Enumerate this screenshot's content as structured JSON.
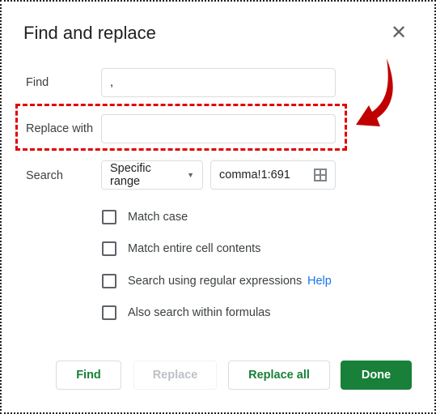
{
  "dialog": {
    "title": "Find and replace",
    "close_icon": "close-icon",
    "find": {
      "label": "Find",
      "value": ","
    },
    "replace": {
      "label": "Replace with",
      "value": "",
      "highlight_color": "#e00000"
    },
    "search": {
      "label": "Search",
      "scope": "Specific range",
      "range": "comma!1:691",
      "range_icon": "grid-icon"
    },
    "options": [
      {
        "label": "Match case",
        "checked": false
      },
      {
        "label": "Match entire cell contents",
        "checked": false
      },
      {
        "label": "Search using regular expressions",
        "checked": false,
        "help": "Help"
      },
      {
        "label": "Also search within formulas",
        "checked": false
      }
    ],
    "buttons": {
      "find": "Find",
      "replace": "Replace",
      "replace_all": "Replace all",
      "done": "Done"
    },
    "accent_color": "#188038"
  }
}
